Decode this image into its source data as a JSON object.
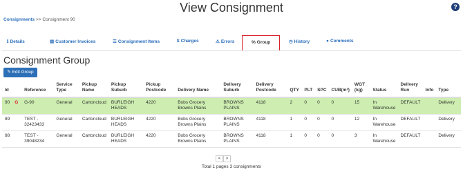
{
  "page": {
    "title": "View Consignment",
    "help_icon": "question-circle-icon"
  },
  "breadcrumb": {
    "link": "Consignments",
    "separator": ">>",
    "current": "Consignment 90"
  },
  "tabs": [
    {
      "label": "Details",
      "icon": "info-icon"
    },
    {
      "label": "Customer Invoices",
      "icon": "invoice-icon"
    },
    {
      "label": "Consignment Items",
      "icon": "list-icon"
    },
    {
      "label": "Charges",
      "icon": "dollar-icon"
    },
    {
      "label": "Errors",
      "icon": "warning-icon"
    },
    {
      "label": "Group",
      "icon": "link-icon",
      "active": true
    },
    {
      "label": "History",
      "icon": "clock-icon"
    },
    {
      "label": "Comments",
      "icon": "comments-icon"
    }
  ],
  "section": {
    "heading": "Consignment Group",
    "edit_button": "Edit Group"
  },
  "table": {
    "headers": [
      "Id",
      "Reference",
      "Service Type",
      "Pickup Name",
      "Pickup Suburb",
      "Pickup Postcode",
      "Delivery Name",
      "Delivery Suburb",
      "Delivery Postcode",
      "QTY",
      "PLT",
      "SPC",
      "CUB(m³)",
      "WGT (kg)",
      "Status",
      "Delivery Run",
      "Info",
      "Type"
    ],
    "rows": [
      {
        "id": "90",
        "badge": "G",
        "reference": "G-90",
        "service_type": "General",
        "pickup_name": "Cartoncloud",
        "pickup_suburb": "BURLEIGH HEADS",
        "pickup_postcode": "4220",
        "delivery_name": "Bobs Grocery Browns Plains",
        "delivery_suburb": "BROWNS PLAINS",
        "delivery_postcode": "4118",
        "qty": "2",
        "plt": "0",
        "spc": "0",
        "cub": "0",
        "wgt": "15",
        "status": "In Warehouse",
        "delivery_run": "DEFAULT",
        "info": "",
        "type": "Delivery"
      },
      {
        "id": "89",
        "badge": "",
        "reference": "TEST - 32423433",
        "service_type": "General",
        "pickup_name": "Cartoncloud",
        "pickup_suburb": "BURLEIGH HEADS",
        "pickup_postcode": "4220",
        "delivery_name": "Bobs Grocery Browns Plains",
        "delivery_suburb": "BROWNS PLAINS",
        "delivery_postcode": "4118",
        "qty": "1",
        "plt": "0",
        "spc": "0",
        "cub": "0",
        "wgt": "12",
        "status": "In Warehouse",
        "delivery_run": "DEFAULT",
        "info": "",
        "type": "Delivery"
      },
      {
        "id": "88",
        "badge": "",
        "reference": "TEST - 39048234",
        "service_type": "General",
        "pickup_name": "Cartoncloud",
        "pickup_suburb": "BURLEIGH HEADS",
        "pickup_postcode": "4220",
        "delivery_name": "Bobs Grocery Browns Plains",
        "delivery_suburb": "BROWNS PLAINS",
        "delivery_postcode": "4118",
        "qty": "1",
        "plt": "0",
        "spc": "0",
        "cub": "0",
        "wgt": "3",
        "status": "In Warehouse",
        "delivery_run": "DEFAULT",
        "info": "",
        "type": "Delivery"
      }
    ]
  },
  "pagination": {
    "prev": "<",
    "next": ">",
    "summary": "Total 1 pages 3 consignments"
  },
  "colors": {
    "accent": "#2a6ebb",
    "highlight_row": "#cdeeb0",
    "active_tab_border": "#d9222a",
    "button": "#2c6fb7"
  }
}
